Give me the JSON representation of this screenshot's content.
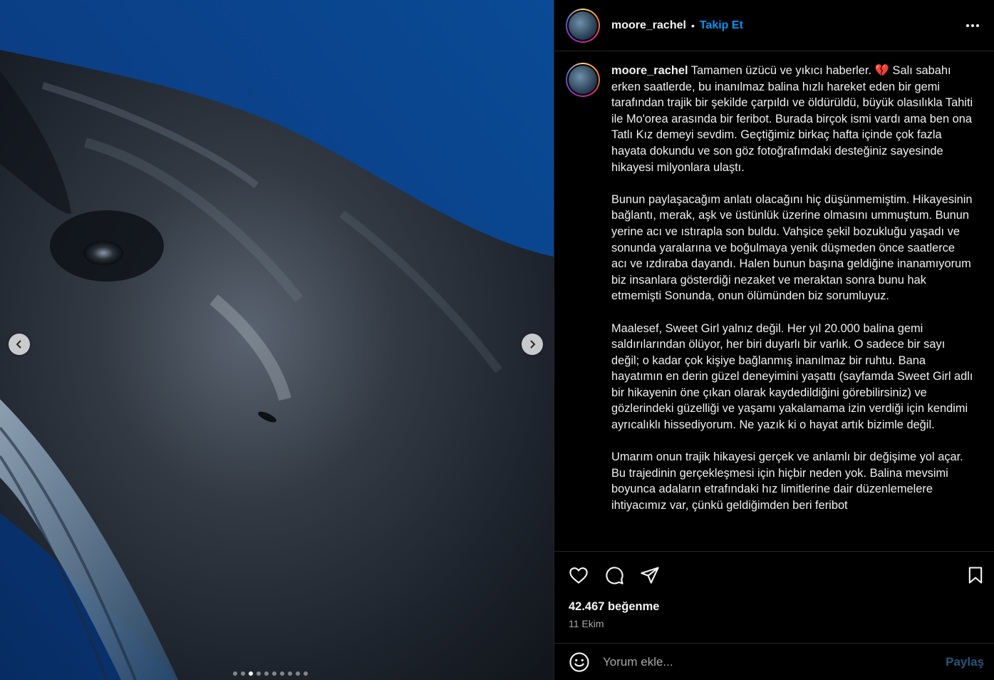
{
  "post": {
    "username": "moore_rachel",
    "follow_label": "Takip Et",
    "separator": "•",
    "more_label": "Daha fazla seçenek"
  },
  "caption": {
    "username": "moore_rachel",
    "text": " Tamamen üzücü ve yıkıcı haberler. 💔 Salı sabahı erken saatlerde, bu inanılmaz balina hızlı hareket eden bir gemi tarafından trajik bir şekilde çarpıldı ve öldürüldü, büyük olasılıkla Tahiti ile Mo'orea arasında bir feribot. Burada birçok ismi vardı ama ben ona Tatlı Kız demeyi sevdim. Geçtiğimiz birkaç hafta içinde çok fazla hayata dokundu ve son göz fotoğrafımdaki desteğiniz sayesinde hikayesi milyonlara ulaştı.\n\nBunun paylaşacağım anlatı olacağını hiç düşünmemiştim. Hikayesinin bağlantı, merak, aşk ve üstünlük üzerine olmasını ummuştum. Bunun yerine acı ve ıstırapla son buldu. Vahşice şekil bozukluğu yaşadı ve sonunda yaralarına ve boğulmaya yenik düşmeden önce saatlerce acı ve ızdıraba dayandı. Halen bunun başına geldiğine inanamıyorum biz insanlara gösterdiği nezaket ve meraktan sonra bunu hak etmemişti Sonunda, onun ölümünden biz sorumluyuz.\n\nMaalesef, Sweet Girl yalnız değil. Her yıl 20.000 balina gemi saldırılarından ölüyor, her biri duyarlı bir varlık. O sadece bir sayı değil; o kadar çok kişiye bağlanmış inanılmaz bir ruhtu. Bana hayatımın en derin güzel deneyimini yaşattı (sayfamda Sweet Girl adlı bir hikayenin öne çıkan olarak kaydedildiğini görebilirsiniz) ve gözlerindeki güzelliği ve yaşamı yakalamama izin verdiği için kendimi ayrıcalıklı hissediyorum. Ne yazık ki o hayat artık bizimle değil.\n\nUmarım onun trajik hikayesi gerçek ve anlamlı bir değişime yol açar. Bu trajedinin gerçekleşmesi için hiçbir neden yok. Balina mevsimi boyunca adaların etrafındaki hız limitlerine dair düzenlemelere ihtiyacımız var, çünkü geldiğimden beri feribot"
  },
  "carousel": {
    "total_slides": 10,
    "active_index": 2
  },
  "stats": {
    "likes": "42.467 beğenme",
    "date": "11 Ekim"
  },
  "comment": {
    "placeholder": "Yorum ekle...",
    "post_label": "Paylaş"
  },
  "colors": {
    "accent": "#0095f6",
    "background": "#000000",
    "border": "#262626",
    "muted": "#a8a8a8",
    "post_disabled": "#28557a"
  }
}
